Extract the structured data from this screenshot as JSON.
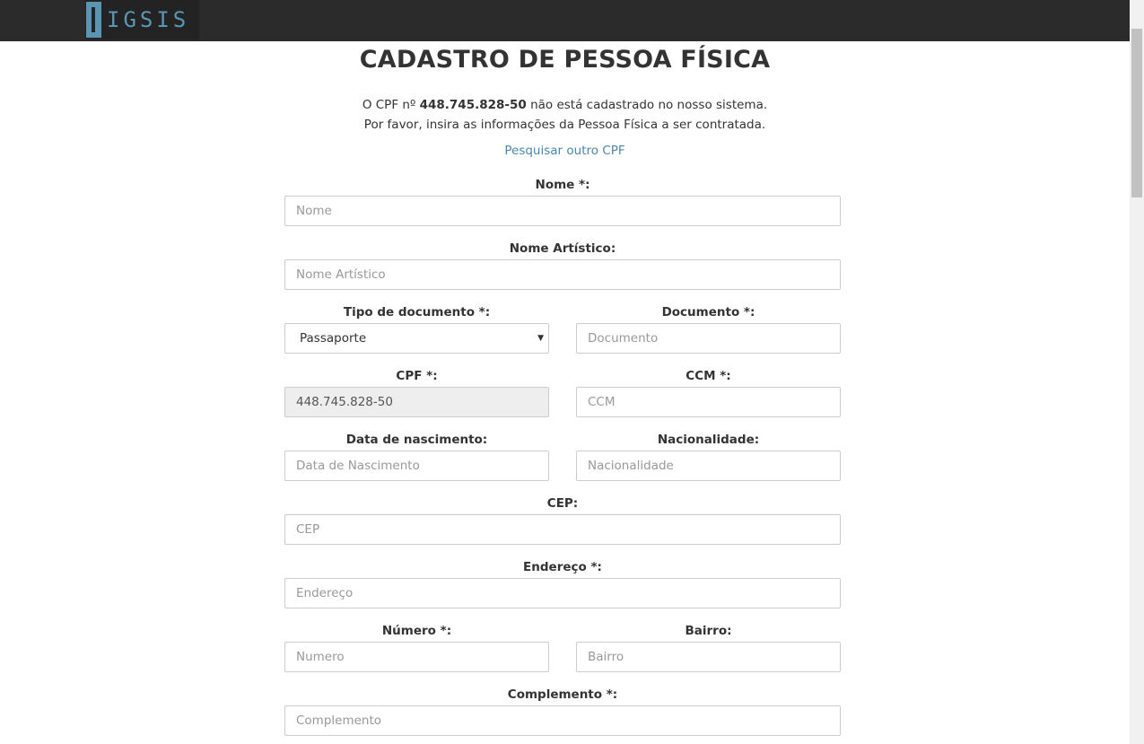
{
  "header": {
    "logo_text": "IGSIS",
    "logo_color": "#5a95b4",
    "bar_color": "#2b2b2b"
  },
  "page": {
    "title": "CADASTRO DE PESSOA FÍSICA",
    "info_prefix": "O CPF nº ",
    "info_cpf": "448.745.828-50",
    "info_suffix": " não está cadastrado no nosso sistema.",
    "info_line2": "Por favor, insira as informações da Pessoa Física a ser contratada.",
    "search_link": "Pesquisar outro CPF",
    "link_color": "#4a88b0"
  },
  "form": {
    "nome": {
      "label": "Nome *:",
      "placeholder": "Nome"
    },
    "nome_artistico": {
      "label": "Nome Artístico:",
      "placeholder": "Nome Artístico"
    },
    "tipo_documento": {
      "label": "Tipo de documento *:",
      "value": "Passaporte"
    },
    "documento": {
      "label": "Documento *:",
      "placeholder": "Documento"
    },
    "cpf": {
      "label": "CPF *:",
      "value": "448.745.828-50"
    },
    "ccm": {
      "label": "CCM *:",
      "placeholder": "CCM"
    },
    "data_nascimento": {
      "label": "Data de nascimento:",
      "placeholder": "Data de Nascimento"
    },
    "nacionalidade": {
      "label": "Nacionalidade:",
      "placeholder": "Nacionalidade"
    },
    "cep": {
      "label": "CEP:",
      "placeholder": "CEP"
    },
    "endereco": {
      "label": "Endereço *:",
      "placeholder": "Endereço"
    },
    "numero": {
      "label": "Número *:",
      "placeholder": "Numero"
    },
    "bairro": {
      "label": "Bairro:",
      "placeholder": "Bairro"
    },
    "complemento": {
      "label": "Complemento *:",
      "placeholder": "Complemento"
    }
  }
}
